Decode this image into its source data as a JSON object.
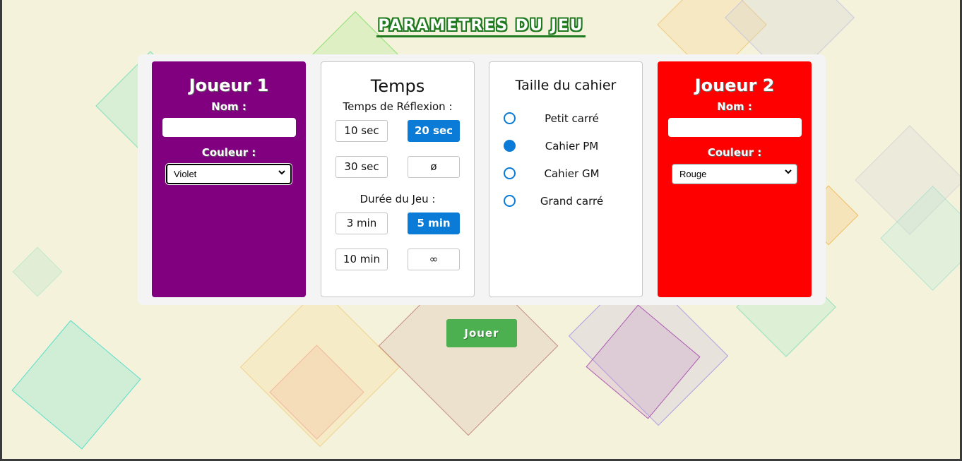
{
  "title": "PARAMETRES DU JEU",
  "player1": {
    "heading": "Joueur 1",
    "name_label": "Nom :",
    "name_value": "",
    "color_label": "Couleur :",
    "color_selected": "Violet",
    "background": "#800080"
  },
  "time": {
    "heading": "Temps",
    "reflection_label": "Temps de Réflexion :",
    "reflection_options": [
      "10 sec",
      "20 sec",
      "30 sec",
      "ø"
    ],
    "reflection_selected": "20 sec",
    "duration_label": "Durée du Jeu :",
    "duration_options": [
      "3 min",
      "5 min",
      "10 min",
      "∞"
    ],
    "duration_selected": "5 min"
  },
  "notebook": {
    "heading": "Taille du cahier",
    "options": [
      "Petit carré",
      "Cahier PM",
      "Cahier GM",
      "Grand carré"
    ],
    "selected": "Cahier PM"
  },
  "player2": {
    "heading": "Joueur 2",
    "name_label": "Nom :",
    "name_value": "",
    "color_label": "Couleur :",
    "color_selected": "Rouge",
    "background": "#ff0000"
  },
  "play_button": "Jouer",
  "colors": {
    "accent_blue": "#0a7bd6",
    "play_green": "#4caf50",
    "title_green": "#1f7a1f",
    "page_bg": "#f5f2dc"
  },
  "icons": {
    "select_arrow": "chevron-down-icon"
  }
}
